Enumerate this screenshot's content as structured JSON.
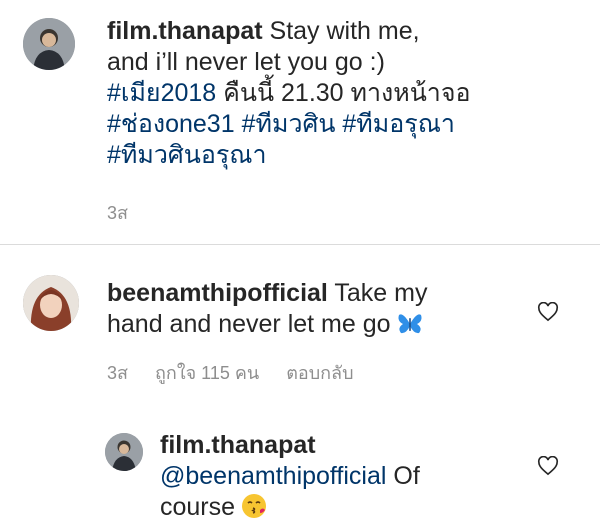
{
  "comment1": {
    "username": "film.thanapat",
    "line1_text": "Stay with me,",
    "line2": "and i’ll never let you go :)",
    "hashtag1": "#เมีย2018",
    "line3_text": "คืนนี้ 21.30 ทางหน้าจอ",
    "hashtag2": "#ช่องone31",
    "hashtag3": "#ทีมวศิน",
    "hashtag4": "#ทีมอรุณา",
    "hashtag5": "#ทีมวศินอรุณา",
    "time": "3ส"
  },
  "comment2": {
    "username": "beenamthipofficial",
    "text1": "Take my",
    "text2": "hand and never let me go",
    "emoji_icon": "blue-butterfly-emoji",
    "time": "3ส",
    "likes": "ถูกใจ 115 คน",
    "reply": "ตอบกลับ"
  },
  "reply1": {
    "username": "film.thanapat",
    "mention": "@beenamthipofficial",
    "text1": "Of",
    "text2": "course",
    "emoji_icon": "kissing-face-emoji"
  },
  "colors": {
    "hashtag": "#003569",
    "meta": "#8e8e8e",
    "divider": "#dbdbdb"
  }
}
